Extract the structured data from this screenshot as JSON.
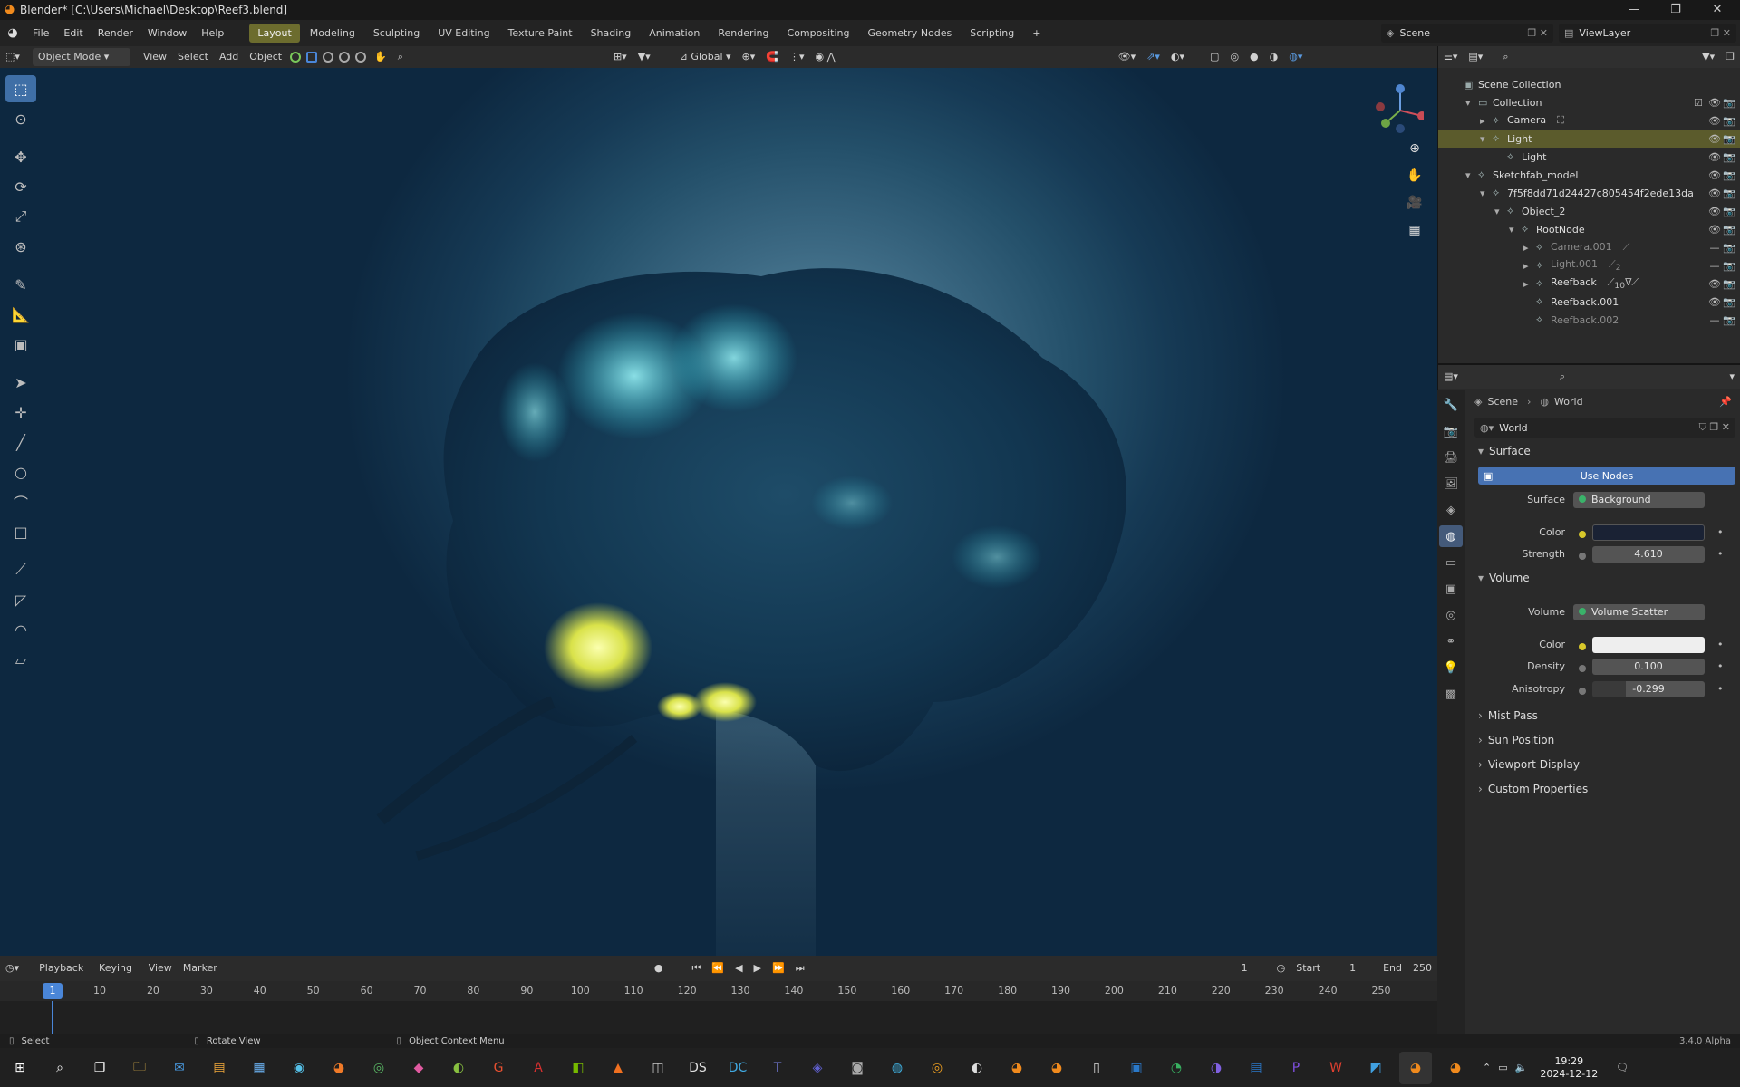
{
  "window": {
    "title": "Blender* [C:\\Users\\Michael\\Desktop\\Reef3.blend]"
  },
  "menubar": {
    "menus": [
      "File",
      "Edit",
      "Render",
      "Window",
      "Help"
    ],
    "workspaces": [
      "Layout",
      "Modeling",
      "Sculpting",
      "UV Editing",
      "Texture Paint",
      "Shading",
      "Animation",
      "Rendering",
      "Compositing",
      "Geometry Nodes",
      "Scripting"
    ],
    "add_tab": "+",
    "scene_label": "Scene",
    "viewlayer_label": "ViewLayer"
  },
  "viewport_header": {
    "mode": "Object Mode",
    "menus": [
      "View",
      "Select",
      "Add",
      "Object"
    ],
    "transform_orientation": "Global"
  },
  "outliner": {
    "rows": [
      {
        "label": "Scene Collection",
        "indent": 0,
        "arrow": "",
        "sel": false,
        "dim": false
      },
      {
        "label": "Collection",
        "indent": 1,
        "arrow": "▾",
        "sel": false,
        "dim": false
      },
      {
        "label": "Camera",
        "indent": 2,
        "arrow": "▸",
        "sel": false,
        "dim": false
      },
      {
        "label": "Light",
        "indent": 2,
        "arrow": "▾",
        "sel": true,
        "dim": false
      },
      {
        "label": "Light",
        "indent": 3,
        "arrow": "",
        "sel": false,
        "dim": false
      },
      {
        "label": "Sketchfab_model",
        "indent": 1,
        "arrow": "▾",
        "sel": false,
        "dim": false
      },
      {
        "label": "7f5f8dd71d24427c805454f2ede13da",
        "indent": 2,
        "arrow": "▾",
        "sel": false,
        "dim": false
      },
      {
        "label": "Object_2",
        "indent": 3,
        "arrow": "▾",
        "sel": false,
        "dim": false
      },
      {
        "label": "RootNode",
        "indent": 4,
        "arrow": "▾",
        "sel": false,
        "dim": false
      },
      {
        "label": "Camera.001",
        "indent": 5,
        "arrow": "▸",
        "sel": false,
        "dim": true
      },
      {
        "label": "Light.001",
        "indent": 5,
        "arrow": "▸",
        "sel": false,
        "dim": true
      },
      {
        "label": "Reefback",
        "indent": 5,
        "arrow": "▸",
        "sel": false,
        "dim": false
      },
      {
        "label": "Reefback.001",
        "indent": 5,
        "arrow": "",
        "sel": false,
        "dim": false
      },
      {
        "label": "Reefback.002",
        "indent": 5,
        "arrow": "",
        "sel": false,
        "dim": true
      }
    ],
    "light_001_count": "2",
    "reefback_count": "10"
  },
  "properties": {
    "breadcrumb": [
      "Scene",
      "World"
    ],
    "datablock": "World",
    "surface": {
      "header": "Surface",
      "use_nodes": "Use Nodes",
      "surface_label": "Surface",
      "surface_value": "Background",
      "color_label": "Color",
      "color_value": "#1a2234",
      "strength_label": "Strength",
      "strength_value": "4.610"
    },
    "volume": {
      "header": "Volume",
      "volume_label": "Volume",
      "volume_value": "Volume Scatter",
      "color_label": "Color",
      "color_value": "#eeeeee",
      "density_label": "Density",
      "density_value": "0.100",
      "anisotropy_label": "Anisotropy",
      "anisotropy_value": "-0.299"
    },
    "collapsed": [
      "Mist Pass",
      "Sun Position",
      "Viewport Display",
      "Custom Properties"
    ]
  },
  "timeline": {
    "menus": [
      "Playback",
      "Keying",
      "View",
      "Marker"
    ],
    "current_frame": "1",
    "start_label": "Start",
    "start_value": "1",
    "end_label": "End",
    "end_value": "250",
    "ticks": [
      "10",
      "20",
      "30",
      "40",
      "50",
      "60",
      "70",
      "80",
      "90",
      "100",
      "110",
      "120",
      "130",
      "140",
      "150",
      "160",
      "170",
      "180",
      "190",
      "200",
      "210",
      "220",
      "230",
      "240",
      "250"
    ],
    "playhead": "1"
  },
  "statusbar": {
    "select": "Select",
    "rotate": "Rotate View",
    "context": "Object Context Menu",
    "version": "3.4.0 Alpha"
  },
  "taskbar": {
    "time": "19:29",
    "date": "2024-12-12"
  }
}
